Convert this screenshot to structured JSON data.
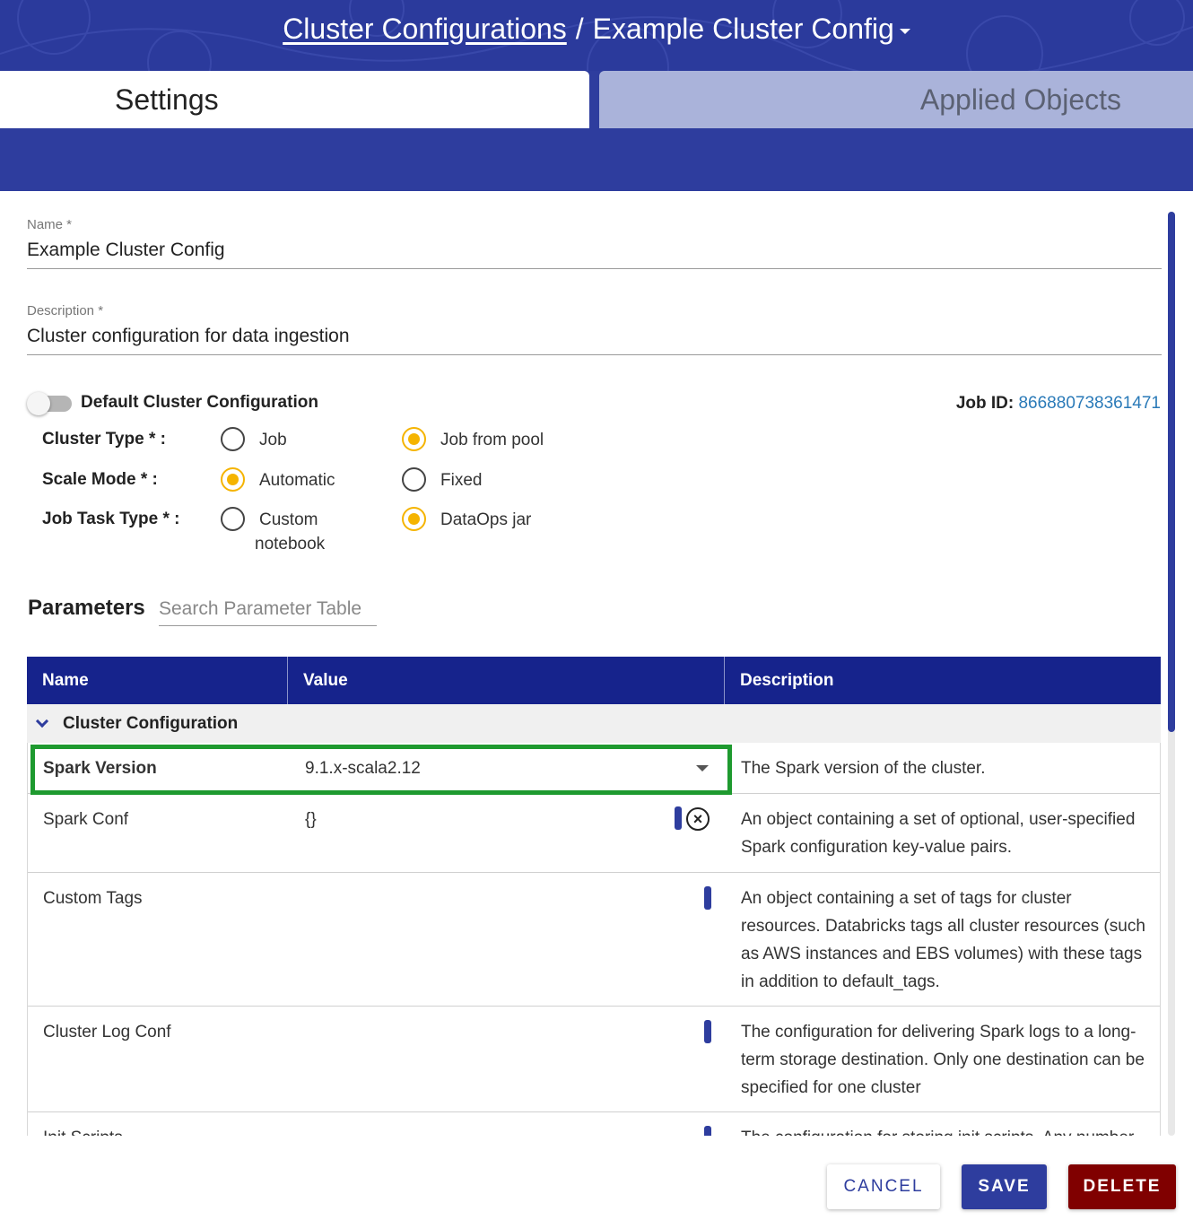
{
  "header": {
    "breadcrumb_link": "Cluster Configurations",
    "separator": "/",
    "current": "Example Cluster Config"
  },
  "tabs": [
    {
      "label": "Settings",
      "active": true
    },
    {
      "label": "Applied Objects",
      "active": false
    }
  ],
  "form": {
    "name_label": "Name *",
    "name_value": "Example Cluster Config",
    "description_label": "Description *",
    "description_value": "Cluster configuration for data ingestion",
    "default_toggle_label": "Default Cluster Configuration",
    "default_toggle_on": false,
    "job_id_label": "Job ID:",
    "job_id_value": "866880738361471"
  },
  "radios": {
    "cluster_type": {
      "label": "Cluster Type * :",
      "options": [
        "Job",
        "Job from pool"
      ],
      "selected": "Job from pool"
    },
    "scale_mode": {
      "label": "Scale Mode * :",
      "options": [
        "Automatic",
        "Fixed"
      ],
      "selected": "Automatic"
    },
    "job_task_type": {
      "label": "Job Task Type * :",
      "options": [
        "Custom",
        "notebook",
        "DataOps jar"
      ],
      "selected": "DataOps jar"
    }
  },
  "parameters": {
    "title": "Parameters",
    "search_placeholder": "Search Parameter Table",
    "columns": [
      "Name",
      "Value",
      "Description"
    ],
    "group": "Cluster Configuration",
    "rows": [
      {
        "name": "Spark Version",
        "value": "9.1.x-scala2.12",
        "description": [
          "The Spark version of the cluster."
        ]
      },
      {
        "name": "Spark Conf",
        "value": "{}",
        "description": [
          "An object containing a set of optional, user-specified",
          "Spark configuration key-value pairs."
        ]
      },
      {
        "name": "Custom Tags",
        "value": "",
        "description": [
          "An object containing a set of tags for cluster",
          "resources. Databricks tags all cluster resources (such",
          "as AWS instances and EBS volumes) with these tags",
          "in addition to default_tags."
        ]
      },
      {
        "name": "Cluster Log Conf",
        "value": "",
        "description": [
          "The configuration for delivering Spark logs to a long-",
          "term storage destination. Only one destination can be",
          "specified for one cluster"
        ]
      },
      {
        "name": "Init Scripts",
        "value": "",
        "description": [
          "The configuration for storing init scripts. Any number"
        ]
      }
    ]
  },
  "actions": {
    "cancel": "CANCEL",
    "save": "SAVE",
    "delete": "DELETE"
  },
  "colors": {
    "header_bg": "#2b3a9c",
    "table_header_bg": "#16238c",
    "radio_selected": "#f5b400",
    "highlight_border": "#1e9a2f",
    "delete_bg": "#800000",
    "link": "#2a7ab8"
  }
}
